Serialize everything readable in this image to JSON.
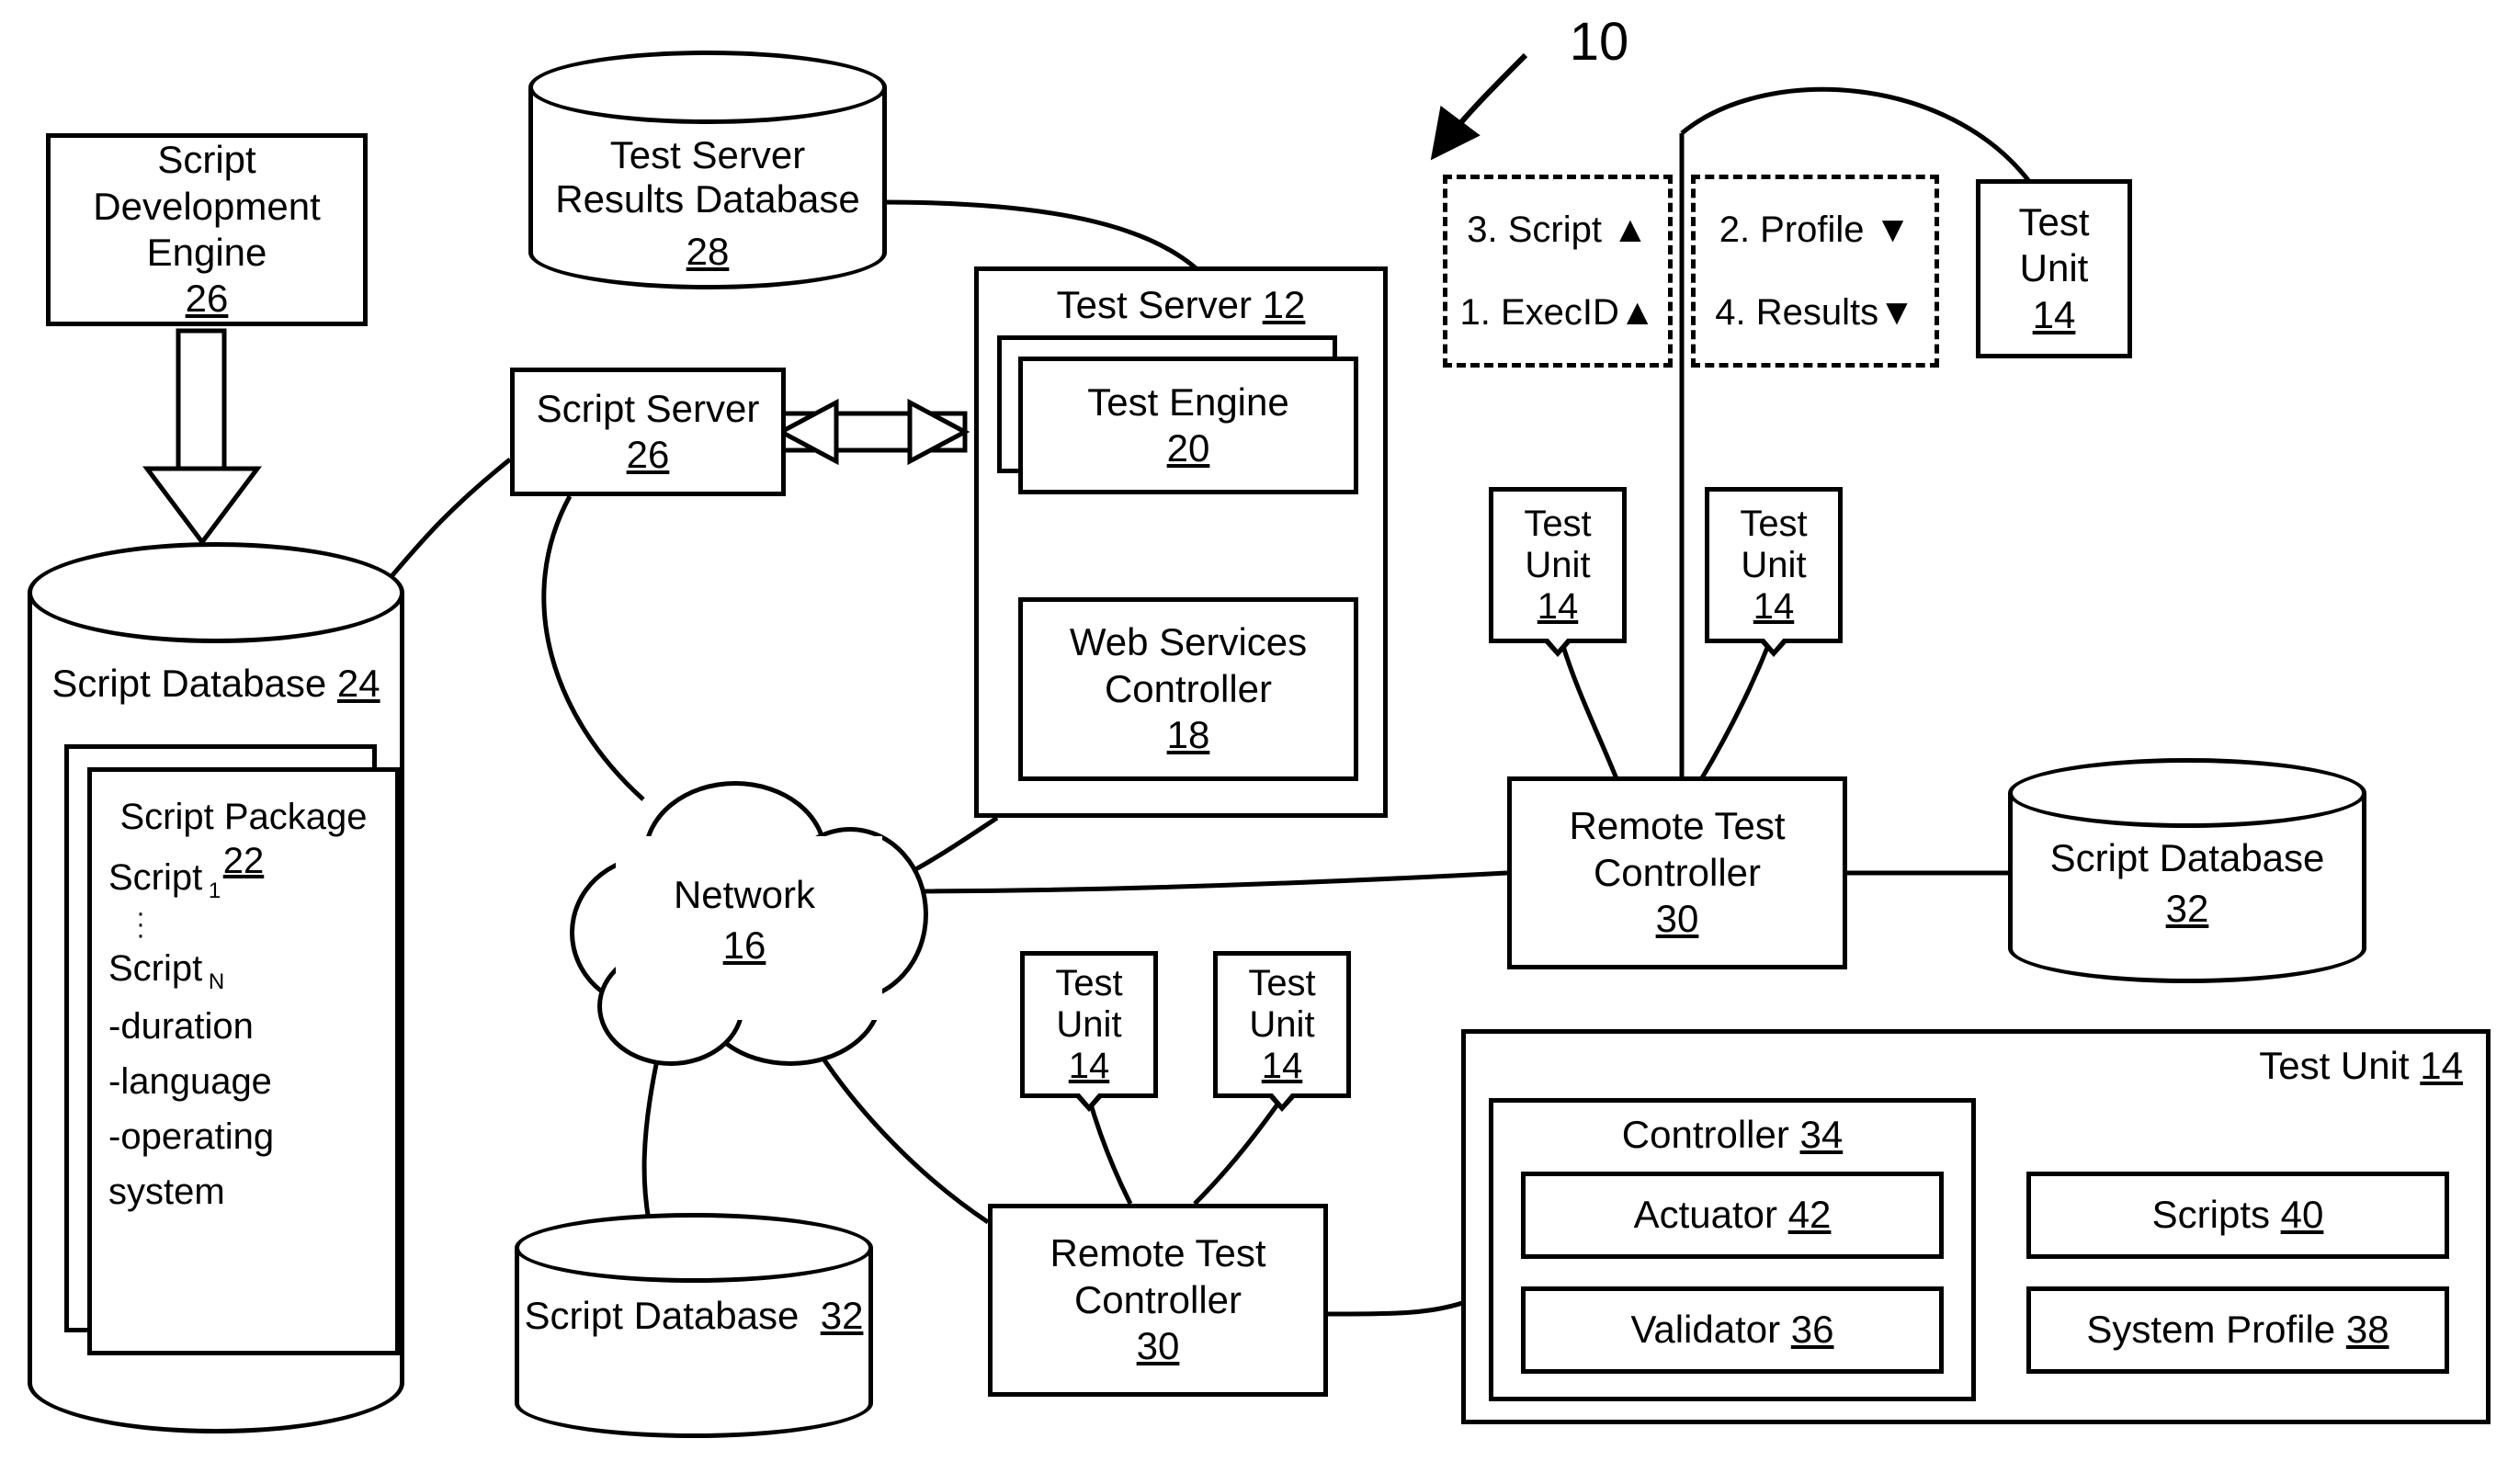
{
  "figure_ref": "10",
  "script_dev_engine": {
    "title": "Script Development\nEngine",
    "num": "26"
  },
  "results_db": {
    "title": "Test Server\nResults Database",
    "num": "28"
  },
  "script_server": {
    "title": "Script Server",
    "num": "26"
  },
  "test_server": {
    "title": "Test Server",
    "num": "12"
  },
  "test_engine": {
    "title": "Test Engine",
    "num": "20"
  },
  "web_services": {
    "title": "Web Services\nController",
    "num": "18"
  },
  "network": {
    "title": "Network",
    "num": "16"
  },
  "script_db_main": {
    "title": "Script Database",
    "num": "24"
  },
  "script_package": {
    "title": "Script Package",
    "num": "22",
    "lines": [
      "Script",
      "Script",
      "-duration",
      "-language",
      "-operating system"
    ]
  },
  "remote_test_controller": {
    "title": "Remote Test\nController",
    "num": "30"
  },
  "script_db_small": {
    "title": "Script Database",
    "num": "32"
  },
  "test_unit": {
    "title": "Test\nUnit",
    "num": "14"
  },
  "test_unit_big": {
    "title": "Test Unit",
    "num": "14"
  },
  "controller": {
    "title": "Controller",
    "num": "34"
  },
  "actuator": {
    "title": "Actuator",
    "num": "42"
  },
  "validator": {
    "title": "Validator",
    "num": "36"
  },
  "scripts": {
    "title": "Scripts",
    "num": "40"
  },
  "system_profile": {
    "title": "System Profile",
    "num": "38"
  },
  "exchange": {
    "left_top": "3. Script",
    "left_bot": "1. ExecID",
    "right_top": "2. Profile",
    "right_bot": "4. Results"
  }
}
